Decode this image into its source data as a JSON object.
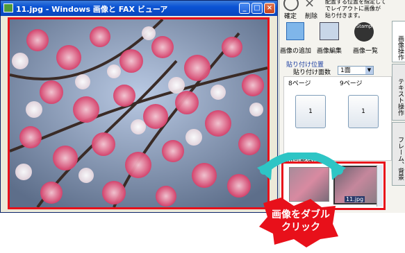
{
  "window": {
    "title": "11.jpg - Windows 画像と FAX ビューア",
    "controls": [
      "minimize-icon",
      "maximize-icon",
      "close-icon"
    ]
  },
  "panel": {
    "top_text": "配置する位置を指定して\nでレイアウトに画像が\n貼り付きます。",
    "confirm_label": "確定",
    "delete_label": "削除",
    "tools": [
      {
        "label": "画像の追加",
        "icon": "add-image-icon"
      },
      {
        "label": "画像編集",
        "icon": "edit-image-icon"
      },
      {
        "label": "画像一覧",
        "icon": "stamp-list-icon",
        "badge": "Stamp"
      }
    ],
    "paste_section": "貼り付け位置",
    "paste_face_label": "貼り付け面数",
    "paste_face_value": "1面",
    "pages": [
      {
        "label": "8ページ",
        "value": "1"
      },
      {
        "label": "9ページ",
        "value": "1"
      }
    ],
    "available_label": "利用可能な画像",
    "thumbs": [
      {
        "caption": ""
      },
      {
        "caption": "11.jpg"
      }
    ],
    "tabs": [
      "画像操作",
      "テキスト操作",
      "フレーム、背景"
    ]
  },
  "callout": {
    "line1": "画像をダブル",
    "line2": "クリック"
  },
  "colors": {
    "highlight": "#e8101a",
    "arrow": "#2ec5c5",
    "titlebar": "#0a53d4"
  }
}
